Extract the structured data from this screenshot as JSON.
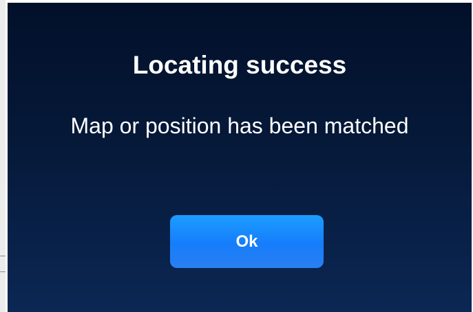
{
  "dialog": {
    "title": "Locating success",
    "message": "Map or position has been matched",
    "ok_label": "Ok"
  },
  "colors": {
    "dialog_background_top": "#02102a",
    "dialog_background_bottom": "#0b2754",
    "button_accent": "#1c8dff",
    "text": "#ffffff"
  }
}
